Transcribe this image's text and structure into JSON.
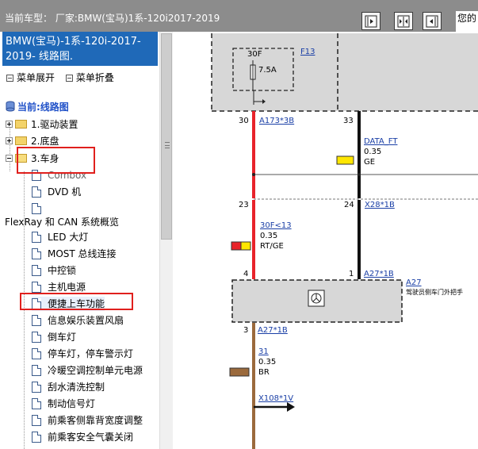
{
  "topbar": {
    "car_label": "当前车型： 厂家:BMW(宝马)1系-120i2017-2019",
    "right_text": "您的",
    "buttons": [
      "split-right",
      "split-both",
      "split-left"
    ]
  },
  "left": {
    "title": "BMW(宝马)-1系-120i-2017-2019- 线路图.",
    "menu_expand": "菜单展开",
    "menu_collapse": "菜单折叠",
    "tree_root": "当前:线路图",
    "folders": [
      "1.驱动装置",
      "2.底盘",
      "3.车身"
    ],
    "items": [
      "Combox",
      "DVD 机",
      "FlexRay 和 CAN 系统概览",
      "LED 大灯",
      "MOST 总线连接",
      "中控锁",
      "主机电源",
      "便捷上车功能",
      "信息娱乐装置风扇",
      "倒车灯",
      "停车灯，停车警示灯",
      "冷暖空调控制单元电源",
      "刮水清洗控制",
      "制动信号灯",
      "前乘客侧靠背宽度调整",
      "前乘客安全气囊关闭"
    ],
    "selected_item": "便捷上车功能"
  },
  "diagram": {
    "fuse_label": "30F",
    "fuse_rating": "7.5A",
    "fuse_link": "F13",
    "pin_30": "30",
    "pin_33": "33",
    "conn_a173": "A173*3B",
    "data_ft": "DATA_FT",
    "gauge_035_a": "0.35",
    "color_ge": "GE",
    "pin_23": "23",
    "pin_24": "24",
    "conn_x28": "X28*1B",
    "wire_30f": "30F<13",
    "gauge_035_b": "0.35",
    "color_rtge": "RT/GE",
    "pin_4": "4",
    "pin_1": "1",
    "conn_a27_1b": "A27*1B",
    "module_a27": "A27",
    "module_desc": "驾驶员侧车门外把手",
    "pin_3": "3",
    "conn_a27_1b_2": "A27*1B",
    "wire_31": "31",
    "gauge_035_c": "0.35",
    "color_br": "BR",
    "conn_x108": "X108*1V"
  },
  "colors": {
    "title_bg": "#1f69b8",
    "topbar_bg": "#8c8c8c",
    "wire_red": "#e8232a",
    "wire_black": "#111111",
    "wire_brown": "#9b6a3c",
    "swatch_yellow": "#ffe600",
    "highlight_red": "#e0201d"
  }
}
